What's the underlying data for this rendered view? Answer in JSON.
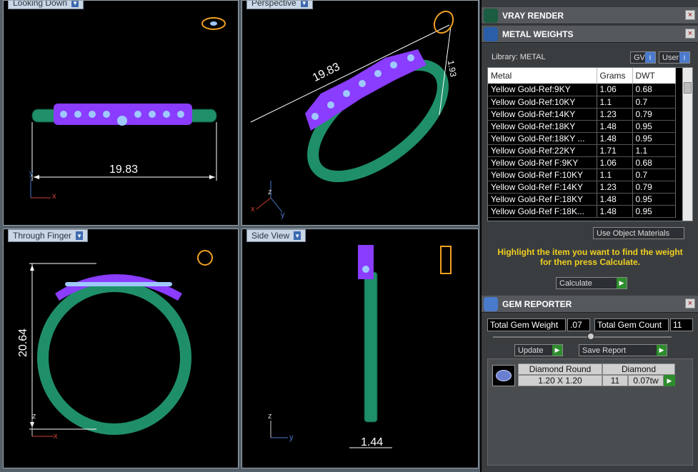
{
  "viewports": {
    "top_left": {
      "label": "Looking Down",
      "dimension": "19.83",
      "axes": [
        "y",
        "x"
      ]
    },
    "top_right": {
      "label": "Perspective",
      "dimension_a": "19.83",
      "dimension_b": "1.93",
      "axes": [
        "z",
        "x",
        "y"
      ]
    },
    "bottom_left": {
      "label": "Through Finger",
      "dimension": "20.64",
      "axes": [
        "z",
        "x"
      ]
    },
    "bottom_right": {
      "label": "Side View",
      "dimension": "1.44",
      "axes": [
        "z",
        "y"
      ]
    }
  },
  "colors": {
    "metal": "#1f8f6a",
    "gem": "#8a3cff",
    "gem_light": "#9fc8ff",
    "dimension": "#ffffff",
    "highlight_text": "#f0d020",
    "accent_blue": "#3d6ab0",
    "go_green": "#2d8d2d"
  },
  "vray": {
    "title": "VRAY RENDER"
  },
  "metal_weights": {
    "title": "METAL WEIGHTS",
    "library_label": "Library: METAL",
    "gv_label": "GV",
    "user_label": "User",
    "columns": [
      "Metal",
      "Grams",
      "DWT"
    ],
    "rows": [
      [
        "Yellow Gold-Ref:9KY",
        "1.06",
        "0.68"
      ],
      [
        "Yellow Gold-Ref:10KY",
        "1.1",
        "0.7"
      ],
      [
        "Yellow Gold-Ref:14KY",
        "1.23",
        "0.79"
      ],
      [
        "Yellow Gold-Ref:18KY",
        "1.48",
        "0.95"
      ],
      [
        "Yellow Gold-Ref:18KY ...",
        "1.48",
        "0.95"
      ],
      [
        "Yellow Gold-Ref:22KY",
        "1.71",
        "1.1"
      ],
      [
        "Yellow Gold-Ref F:9KY",
        "1.06",
        "0.68"
      ],
      [
        "Yellow Gold-Ref F:10KY",
        "1.1",
        "0.7"
      ],
      [
        "Yellow Gold-Ref F:14KY",
        "1.23",
        "0.79"
      ],
      [
        "Yellow Gold-Ref F:18KY",
        "1.48",
        "0.95"
      ],
      [
        "Yellow Gold-Ref F:18K...",
        "1.48",
        "0.95"
      ]
    ],
    "use_object_materials": "Use Object Materials",
    "hint": "Highlight the item you want to find the weight for then press Calculate.",
    "calculate": "Calculate"
  },
  "gem_reporter": {
    "title": "GEM REPORTER",
    "total_weight_label": "Total Gem Weight",
    "total_weight_value": ".07",
    "total_count_label": "Total Gem Count",
    "total_count_value": "11",
    "update_label": "Update",
    "save_report_label": "Save Report",
    "gem": {
      "shape": "Diamond Round",
      "size": "1.20 X 1.20",
      "material": "Diamond",
      "count": "11",
      "weight": "0.07tw"
    }
  }
}
